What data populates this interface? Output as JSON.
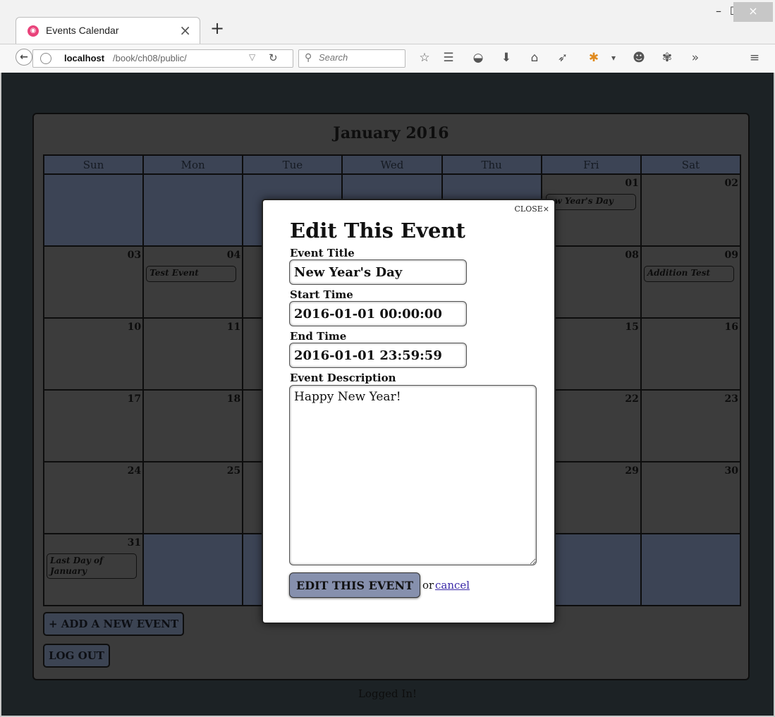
{
  "browser": {
    "tab_title": "Events Calendar",
    "tab_close": "×",
    "new_tab": "+",
    "url_host": "localhost",
    "url_path": "/book/ch08/public/",
    "search_placeholder": "Search",
    "window_min": "–",
    "window_max": "☐",
    "window_close": "×",
    "more": "»"
  },
  "calendar": {
    "month_title": "January 2016",
    "weekdays": [
      "Sun",
      "Mon",
      "Tue",
      "Wed",
      "Thu",
      "Fri",
      "Sat"
    ],
    "days": {
      "d01": "01",
      "d02": "02",
      "d03": "03",
      "d04": "04",
      "d08": "08",
      "d09": "09",
      "d10": "10",
      "d11": "11",
      "d15": "15",
      "d16": "16",
      "d17": "17",
      "d18": "18",
      "d22": "22",
      "d23": "23",
      "d24": "24",
      "d25": "25",
      "d29": "29",
      "d30": "30",
      "d31": "31"
    },
    "events": {
      "new_years": "ew Year's Day",
      "test": "Test Event",
      "addition": "Addition Test",
      "last_day": "Last Day of January"
    },
    "add_event_button": "+ ADD A NEW EVENT",
    "logout_button": "LOG OUT",
    "status": "Logged In!"
  },
  "modal": {
    "close_label": "CLOSE×",
    "heading": "Edit This Event",
    "title_label": "Event Title",
    "title_value": "New Year's Day",
    "start_label": "Start Time",
    "start_value": "2016-01-01 00:00:00",
    "end_label": "End Time",
    "end_value": "2016-01-01 23:59:59",
    "description_label": "Event Description",
    "description_value": "Happy New Year!",
    "submit_label": "EDIT THIS EVENT",
    "or_text": "or",
    "cancel_label": "cancel"
  },
  "colors": {
    "page_background": "#1c2225",
    "calendar_panel": "#3b3b3b",
    "empty_day": "#3c4455",
    "submit_button": "#8690ad",
    "cancel_link": "#3b2aa8"
  }
}
